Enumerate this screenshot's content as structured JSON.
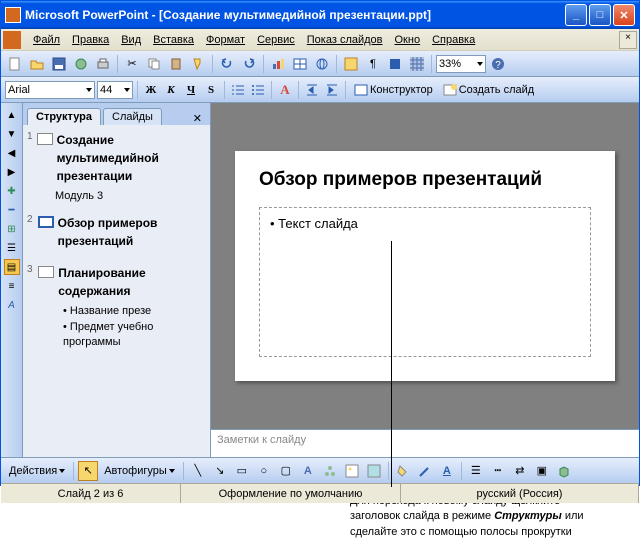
{
  "titlebar": {
    "app": "Microsoft PowerPoint",
    "doc": "[Создание мультимедийной презентации.ppt]"
  },
  "menus": [
    "Файл",
    "Правка",
    "Вид",
    "Вставка",
    "Формат",
    "Сервис",
    "Показ слайдов",
    "Окно",
    "Справка"
  ],
  "zoom": "33%",
  "font": {
    "name": "Arial",
    "size": "44"
  },
  "fmt_btns": {
    "b": "Ж",
    "i": "К",
    "u": "Ч",
    "s": "S",
    "a_txt": "A",
    "konstruktor": "Конструктор",
    "new_slide": "Создать слайд"
  },
  "tabs": {
    "outline": "Структура",
    "slides": "Слайды"
  },
  "outline": [
    {
      "n": "1",
      "title": "Создание мультимедийной презентации",
      "sub": "Модуль 3"
    },
    {
      "n": "2",
      "title": "Обзор примеров презентаций",
      "selected": true
    },
    {
      "n": "3",
      "title": "Планирование содержания",
      "bullets": [
        "Название презе",
        "Предмет учебно программы"
      ]
    }
  ],
  "slide": {
    "title": "Обзор примеров презентаций",
    "body": "Текст слайда"
  },
  "notes": "Заметки к слайду",
  "draw": {
    "actions": "Действия",
    "autoshapes": "Автофигуры"
  },
  "status": {
    "slide": "Слайд 2 из 6",
    "design": "Оформление по умолчанию",
    "lang": "русский (Россия)"
  },
  "caption": {
    "l1": "Для перехода к новому слайду щелкните",
    "l2a": "заголовок слайда в режиме ",
    "l2b": "Структуры",
    "l2c": " или",
    "l3": "сделайте это с помощью полосы прокрутки"
  }
}
